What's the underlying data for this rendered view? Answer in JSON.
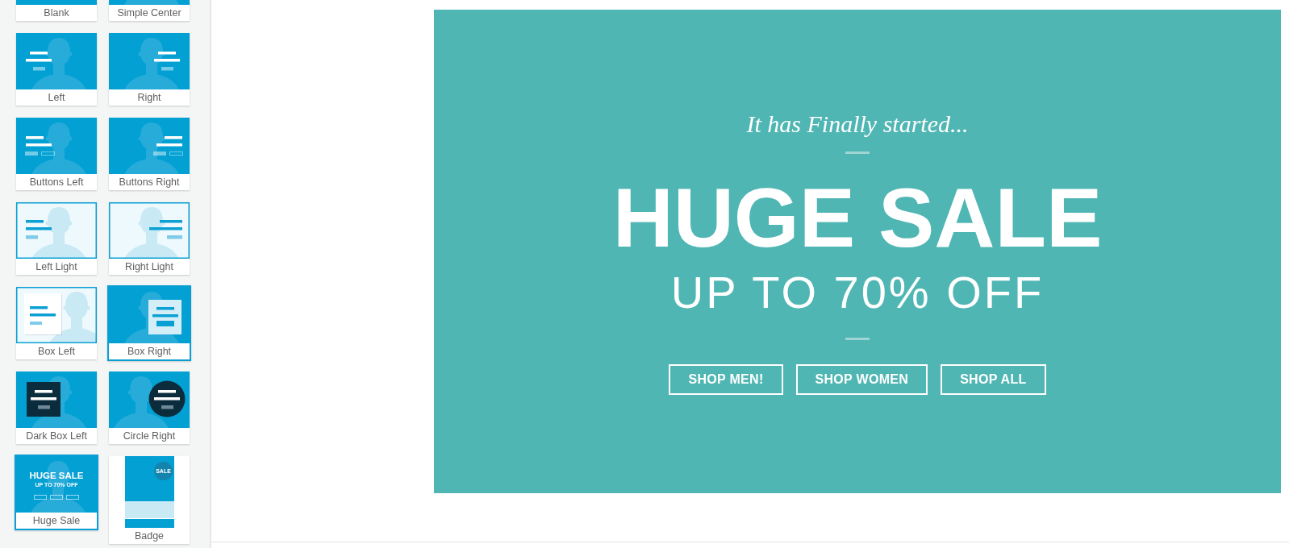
{
  "sidebar": {
    "templates": [
      {
        "label": "Blank",
        "kind": "blank",
        "selected": false,
        "cut_off": true
      },
      {
        "label": "Simple Center",
        "kind": "simple-center",
        "selected": false,
        "cut_off": true
      },
      {
        "label": "Left",
        "kind": "left",
        "selected": false,
        "cut_off": false
      },
      {
        "label": "Right",
        "kind": "right",
        "selected": false,
        "cut_off": false
      },
      {
        "label": "Buttons Left",
        "kind": "buttons-left",
        "selected": false,
        "cut_off": false
      },
      {
        "label": "Buttons Right",
        "kind": "buttons-right",
        "selected": false,
        "cut_off": false
      },
      {
        "label": "Left Light",
        "kind": "left-light",
        "selected": false,
        "cut_off": false
      },
      {
        "label": "Right Light",
        "kind": "right-light",
        "selected": false,
        "cut_off": false
      },
      {
        "label": "Box Left",
        "kind": "box-left",
        "selected": false,
        "cut_off": false
      },
      {
        "label": "Box Right",
        "kind": "box-right",
        "selected": true,
        "cut_off": false
      },
      {
        "label": "Dark Box Left",
        "kind": "dark-box-left",
        "selected": false,
        "cut_off": false
      },
      {
        "label": "Circle Right",
        "kind": "circle-right",
        "selected": false,
        "cut_off": false
      },
      {
        "label": "Huge Sale",
        "kind": "huge-sale",
        "selected": true,
        "cut_off": false,
        "thumbnail": {
          "title": "HUGE SALE",
          "subtitle": "UP TO 70% OFF"
        }
      },
      {
        "label": "Badge",
        "kind": "badge",
        "selected": false,
        "cut_off": false,
        "thumbnail": {
          "badge": "SALE"
        }
      }
    ]
  },
  "canvas": {
    "banner": {
      "tagline": "It has Finally started...",
      "headline": "HUGE SALE",
      "subheadline": "UP TO 70% OFF",
      "buttons": [
        "SHOP MEN!",
        "SHOP WOMEN",
        "SHOP ALL"
      ]
    }
  }
}
